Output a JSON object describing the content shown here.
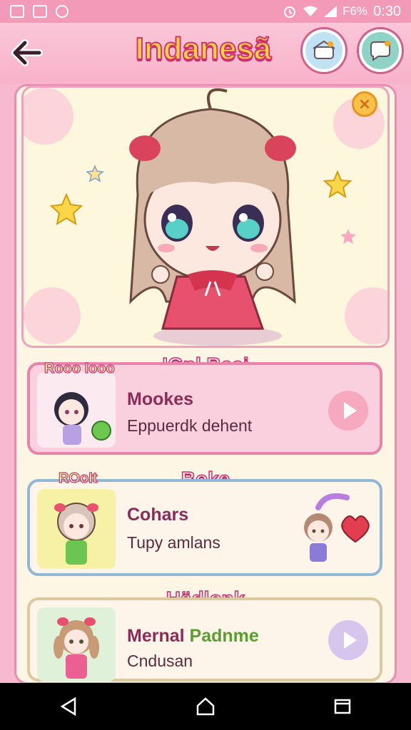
{
  "status_bar": {
    "battery": "F6%",
    "time": "0:30",
    "icons": [
      "image-icon",
      "gallery-icon",
      "sync-icon",
      "alarm-icon",
      "wifi-icon",
      "signal-icon"
    ]
  },
  "header": {
    "title": "Indanesã",
    "back_icon": "arrow-left-icon",
    "home_icon": "house-icon",
    "chat_icon": "chat-bubble-icon"
  },
  "hero": {
    "character": "chibi-girl-illustration",
    "close_icon": "close-x-icon"
  },
  "sections": [
    {
      "heading": "IGnl Beai",
      "badge": "Rooo Iooo",
      "title": "Mookes",
      "subtitle": "Eppuerdk dehent",
      "action_icon": "play-icon"
    },
    {
      "heading": "Boke",
      "badge": "ROoIt",
      "title": "Cohars",
      "subtitle": "Tupy amlans"
    },
    {
      "heading": "Hädlonk",
      "title_part1": "Mernal",
      "title_part2": "Padnme",
      "subtitle": "Cndusan",
      "action_icon": "play-icon"
    }
  ],
  "colors": {
    "background": "#f7b9cf",
    "header": "#f8b2ca",
    "panel": "#fdf6e4",
    "accent_pink": "#e883a9",
    "accent_blue": "#90b8d6",
    "title_yellow": "#ffd53e",
    "highlight_green": "#5a9e2f"
  },
  "navigation": {
    "back_icon": "nav-back-icon",
    "home_icon": "nav-home-icon",
    "recents_icon": "nav-recents-icon"
  }
}
